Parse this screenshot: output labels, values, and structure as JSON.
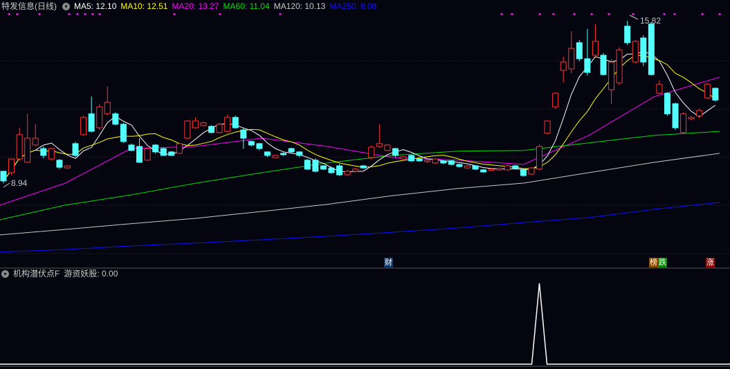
{
  "header": {
    "title": "特发信息(日线)",
    "menu_icon": "chevron-down-circle-icon",
    "ma": [
      {
        "label": "MA5: 12.10",
        "color": "#ffffff"
      },
      {
        "label": "MA10: 12.51",
        "color": "#ffff00"
      },
      {
        "label": "MA20: 13.27",
        "color": "#ff00ff"
      },
      {
        "label": "MA60: 11.04",
        "color": "#00e000"
      },
      {
        "label": "MA120: 10.13",
        "color": "#c8c8c8"
      },
      {
        "label": "MA250: 8.08",
        "color": "#0000ff"
      }
    ]
  },
  "markers": {
    "cai": {
      "label": "财",
      "color": "#0d3a6e"
    },
    "bang": {
      "label": "榜",
      "color": "#8a4a00"
    },
    "die": {
      "label": "跌",
      "color": "#0a8a0a"
    },
    "zhang": {
      "label": "涨",
      "color": "#8a0a0a"
    }
  },
  "indicator": {
    "name": "机构潜伏点F",
    "value_label": "游资妖股: 0.00"
  },
  "chart_data": {
    "type": "candlestick",
    "high_label": "15.82",
    "low_label": "8.94",
    "price_range": [
      5.8,
      16.3
    ],
    "up_color": "#ff3232",
    "down_color": "#54ffff",
    "candles": [
      [
        9.45,
        9.04,
        9.45,
        8.94
      ],
      [
        9.39,
        9.97,
        10.0,
        9.3
      ],
      [
        9.97,
        11.0,
        11.29,
        9.9
      ],
      [
        9.83,
        10.85,
        11.88,
        9.8
      ],
      [
        10.56,
        10.85,
        11.44,
        10.5
      ],
      [
        10.41,
        10.12,
        10.5,
        10.0
      ],
      [
        9.97,
        10.41,
        10.45,
        9.9
      ],
      [
        9.92,
        9.62,
        9.97,
        9.55
      ],
      [
        9.59,
        9.68,
        9.7,
        9.55
      ],
      [
        10.62,
        10.12,
        10.7,
        10.05
      ],
      [
        11.0,
        11.73,
        11.8,
        10.95
      ],
      [
        11.88,
        11.14,
        12.61,
        11.1
      ],
      [
        11.29,
        12.17,
        12.3,
        11.2
      ],
      [
        11.88,
        12.37,
        13.04,
        11.8
      ],
      [
        11.88,
        11.44,
        11.95,
        11.4
      ],
      [
        11.44,
        10.71,
        11.5,
        10.65
      ],
      [
        10.56,
        10.33,
        10.62,
        10.3
      ],
      [
        10.5,
        9.83,
        10.85,
        9.8
      ],
      [
        9.92,
        10.41,
        10.45,
        9.9
      ],
      [
        10.56,
        10.27,
        10.6,
        10.2
      ],
      [
        10.41,
        10.12,
        10.45,
        10.1
      ],
      [
        10.27,
        10.12,
        10.3,
        10.1
      ],
      [
        10.21,
        10.62,
        10.65,
        10.2
      ],
      [
        10.85,
        11.58,
        11.6,
        10.8
      ],
      [
        11.29,
        11.58,
        11.73,
        11.25
      ],
      [
        11.38,
        11.5,
        11.55,
        11.35
      ],
      [
        11.35,
        11.09,
        11.4,
        11.05
      ],
      [
        11.09,
        11.44,
        11.5,
        11.05
      ],
      [
        11.14,
        11.73,
        11.85,
        11.1
      ],
      [
        11.73,
        11.29,
        11.8,
        11.25
      ],
      [
        11.2,
        10.85,
        11.3,
        10.4
      ],
      [
        10.71,
        10.56,
        10.75,
        10.5
      ],
      [
        10.62,
        10.41,
        10.65,
        10.35
      ],
      [
        10.27,
        10.12,
        10.3,
        10.05
      ],
      [
        10.03,
        10.12,
        10.15,
        10.0
      ],
      [
        10.21,
        10.15,
        10.25,
        10.1
      ],
      [
        10.41,
        10.27,
        10.45,
        10.2
      ],
      [
        10.27,
        10.12,
        10.3,
        10.05
      ],
      [
        9.92,
        9.54,
        9.97,
        9.5
      ],
      [
        9.92,
        9.45,
        10.0,
        9.4
      ],
      [
        9.68,
        9.54,
        9.7,
        9.5
      ],
      [
        9.59,
        9.39,
        9.65,
        9.35
      ],
      [
        9.68,
        9.3,
        9.75,
        9.25
      ],
      [
        9.3,
        9.45,
        9.5,
        9.25
      ],
      [
        9.45,
        9.54,
        9.6,
        9.4
      ],
      [
        9.68,
        9.59,
        9.72,
        9.55
      ],
      [
        10.03,
        10.47,
        10.55,
        9.95
      ],
      [
        10.5,
        10.62,
        11.44,
        10.45
      ],
      [
        10.33,
        10.56,
        10.6,
        10.3
      ],
      [
        10.41,
        10.12,
        10.45,
        10.05
      ],
      [
        9.97,
        10.06,
        10.1,
        9.9
      ],
      [
        10.12,
        9.89,
        10.15,
        9.85
      ],
      [
        9.97,
        9.89,
        10.0,
        9.85
      ],
      [
        9.86,
        9.92,
        9.97,
        9.8
      ],
      [
        9.8,
        9.97,
        10.0,
        9.75
      ],
      [
        9.89,
        9.8,
        9.92,
        9.75
      ],
      [
        9.89,
        9.74,
        9.92,
        9.7
      ],
      [
        9.74,
        9.65,
        9.78,
        9.6
      ],
      [
        9.59,
        9.68,
        9.72,
        9.55
      ],
      [
        9.68,
        9.54,
        9.72,
        9.5
      ],
      [
        9.51,
        9.42,
        9.55,
        9.38
      ],
      [
        9.48,
        9.54,
        9.58,
        9.45
      ],
      [
        9.51,
        9.57,
        9.6,
        9.48
      ],
      [
        9.51,
        9.68,
        9.72,
        9.48
      ],
      [
        9.68,
        9.57,
        9.72,
        9.52
      ],
      [
        9.51,
        9.27,
        9.55,
        9.22
      ],
      [
        9.33,
        9.59,
        9.62,
        9.3
      ],
      [
        9.54,
        10.5,
        10.6,
        9.5
      ],
      [
        11.06,
        11.58,
        11.6,
        11.0
      ],
      [
        12.17,
        12.75,
        12.8,
        12.1
      ],
      [
        13.72,
        14.07,
        14.3,
        13.2
      ],
      [
        13.78,
        14.65,
        15.38,
        13.6
      ],
      [
        14.89,
        14.21,
        15.0,
        14.1
      ],
      [
        14.21,
        13.63,
        15.47,
        13.5
      ],
      [
        14.36,
        14.95,
        15.68,
        14.3
      ],
      [
        14.36,
        13.54,
        14.45,
        13.5
      ],
      [
        12.9,
        14.07,
        14.2,
        12.31
      ],
      [
        13.19,
        14.59,
        14.7,
        13.1
      ],
      [
        15.59,
        14.89,
        15.82,
        14.8
      ],
      [
        14.07,
        14.95,
        15.0,
        14.0
      ],
      [
        15.09,
        14.07,
        15.2,
        13.9
      ],
      [
        15.68,
        13.54,
        15.75,
        13.5
      ],
      [
        12.75,
        13.13,
        13.3,
        12.7
      ],
      [
        12.75,
        11.88,
        12.8,
        11.8
      ],
      [
        12.31,
        11.29,
        12.35,
        11.2
      ],
      [
        11.09,
        11.88,
        11.95,
        11.05
      ],
      [
        11.67,
        11.73,
        11.8,
        11.6
      ],
      [
        11.79,
        12.02,
        12.1,
        11.7
      ],
      [
        12.55,
        13.13,
        13.2,
        12.5
      ],
      [
        12.96,
        12.46,
        13.0,
        12.4
      ]
    ],
    "ma_samples": {
      "MA20": [
        8.02,
        8.95,
        10.41,
        10.5,
        10.85,
        10.5,
        10.03,
        9.92,
        9.74,
        10.97,
        12.61,
        13.43
      ],
      "MA60": [
        7.4,
        8.02,
        8.45,
        8.95,
        9.39,
        9.8,
        10.12,
        10.3,
        10.33,
        10.65,
        10.97,
        11.14
      ],
      "MA120": [
        6.76,
        6.99,
        7.23,
        7.46,
        7.75,
        8.05,
        8.42,
        8.72,
        8.95,
        9.39,
        9.83,
        10.21
      ],
      "MA250": [
        6.03,
        6.14,
        6.29,
        6.41,
        6.55,
        6.7,
        6.87,
        7.05,
        7.28,
        7.49,
        7.84,
        8.13
      ]
    },
    "indicator_series": {
      "name": "游资妖股",
      "signal_index": 67,
      "range": [
        0,
        1
      ]
    }
  }
}
